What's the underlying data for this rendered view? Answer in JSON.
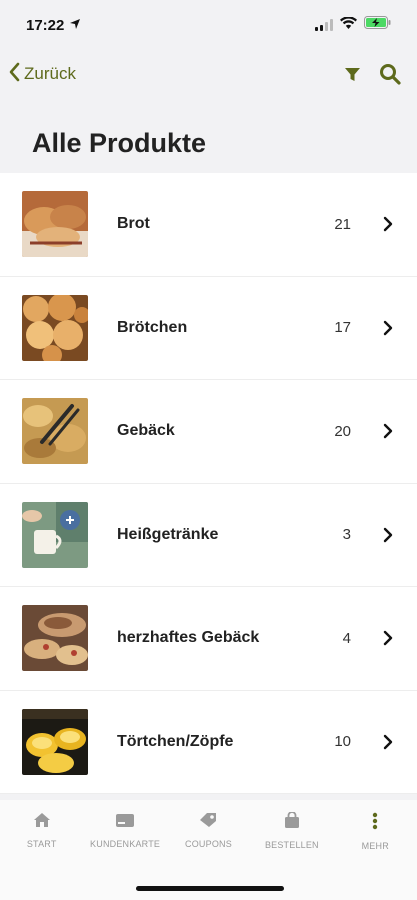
{
  "status": {
    "time": "17:22"
  },
  "nav": {
    "back_label": "Zurück"
  },
  "page": {
    "title": "Alle Produkte"
  },
  "products": [
    {
      "label": "Brot",
      "count": "21"
    },
    {
      "label": "Brötchen",
      "count": "17"
    },
    {
      "label": "Gebäck",
      "count": "20"
    },
    {
      "label": "Heißgetränke",
      "count": "3"
    },
    {
      "label": "herzhaftes Gebäck",
      "count": "4"
    },
    {
      "label": "Törtchen/Zöpfe",
      "count": "10"
    }
  ],
  "tabs": [
    {
      "label": "START",
      "icon": "home-icon"
    },
    {
      "label": "KUNDENKARTE",
      "icon": "card-icon"
    },
    {
      "label": "COUPONS",
      "icon": "tag-icon"
    },
    {
      "label": "BESTELLEN",
      "icon": "bag-icon"
    },
    {
      "label": "MEHR",
      "icon": "more-icon"
    }
  ],
  "colors": {
    "accent": "#5e6a1c",
    "more_active": "#5e6a1c",
    "tab_inactive": "#9a9a9a"
  }
}
